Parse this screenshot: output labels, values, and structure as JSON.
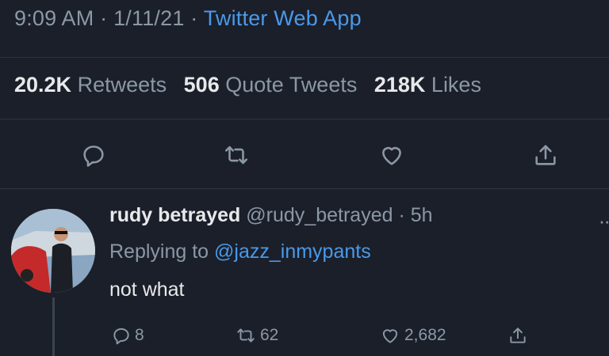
{
  "tweet_meta": {
    "time": "9:09 AM",
    "date": "1/11/21",
    "separator": "·",
    "app": "Twitter Web App"
  },
  "stats": {
    "retweets_count": "20.2K",
    "retweets_label": "Retweets",
    "quotes_count": "506",
    "quotes_label": "Quote Tweets",
    "likes_count": "218K",
    "likes_label": "Likes"
  },
  "actions": {
    "icons": [
      "reply-icon",
      "retweet-icon",
      "like-icon",
      "share-icon"
    ]
  },
  "reply": {
    "display_name": "rudy betrayed",
    "handle": "@rudy_betrayed",
    "separator": "·",
    "age": "5h",
    "replying_prefix": "Replying to",
    "replying_to": "@jazz_inmypants",
    "text": "not what",
    "reply_count": "8",
    "retweet_count": "62",
    "like_count": "2,682"
  },
  "colors": {
    "background": "#1b1f2a",
    "accent": "#4a99e9",
    "muted": "#8b98a5",
    "text": "#e7e9ea"
  }
}
